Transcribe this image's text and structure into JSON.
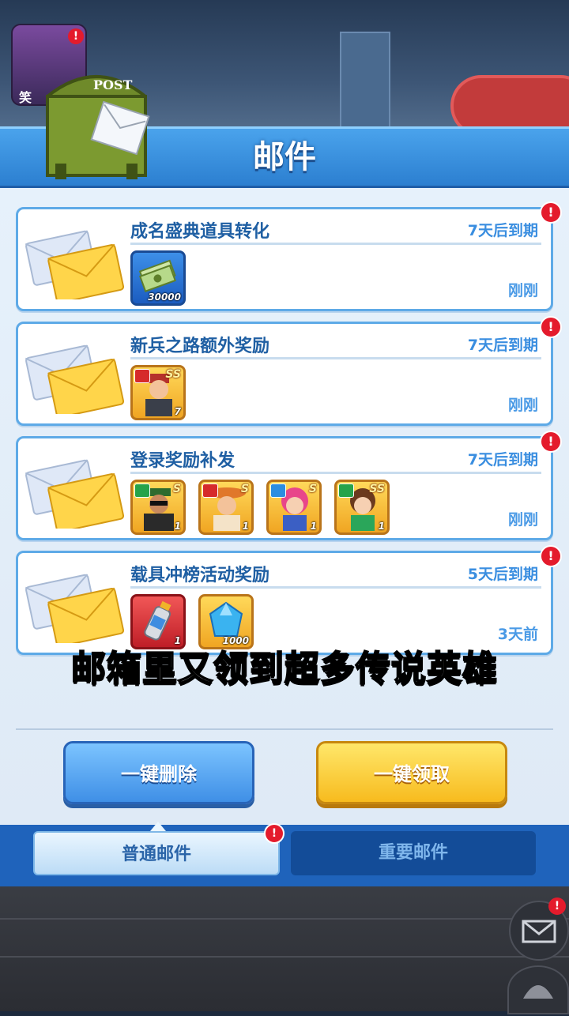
{
  "header": {
    "title": "邮件",
    "mailbox_sign": "POST"
  },
  "top_left": {
    "label": "笑"
  },
  "mails": [
    {
      "title": "成名盛典道具转化",
      "expire": "7天后到期",
      "time": "刚刚",
      "items": [
        {
          "name": "cash-bundle-icon",
          "style": "blue",
          "count": "30000"
        }
      ]
    },
    {
      "title": "新兵之路额外奖励",
      "expire": "7天后到期",
      "time": "刚刚",
      "items": [
        {
          "name": "hero-soldier-icon",
          "style": "gold",
          "rank": "SS",
          "count": "7"
        }
      ]
    },
    {
      "title": "登录奖励补发",
      "expire": "7天后到期",
      "time": "刚刚",
      "items": [
        {
          "name": "hero-sunglasses-icon",
          "style": "gold",
          "rank": "S",
          "count": "1"
        },
        {
          "name": "hero-cowboy-icon",
          "style": "gold",
          "rank": "S",
          "count": "1"
        },
        {
          "name": "hero-pink-hair-icon",
          "style": "gold",
          "rank": "S",
          "count": "1"
        },
        {
          "name": "hero-brown-hair-icon",
          "style": "gold",
          "rank": "SS",
          "count": "1"
        }
      ]
    },
    {
      "title": "载具冲榜活动奖励",
      "expire": "5天后到期",
      "time": "3天前",
      "items": [
        {
          "name": "fuel-canister-icon",
          "style": "red",
          "count": "1"
        },
        {
          "name": "blue-gem-icon",
          "style": "gold",
          "count": "1000"
        }
      ]
    }
  ],
  "subtitle": "邮箱里又领到超多传说英雄",
  "buttons": {
    "delete_all": "一键删除",
    "claim_all": "一键领取"
  },
  "tabs": {
    "normal": "普通邮件",
    "important": "重要邮件"
  },
  "badge": "!",
  "colors": {
    "header_blue": "#2c7fd0",
    "accent_text": "#1f5fa3",
    "claim_yellow": "#f7bb1e",
    "badge_red": "#e41b2c"
  }
}
